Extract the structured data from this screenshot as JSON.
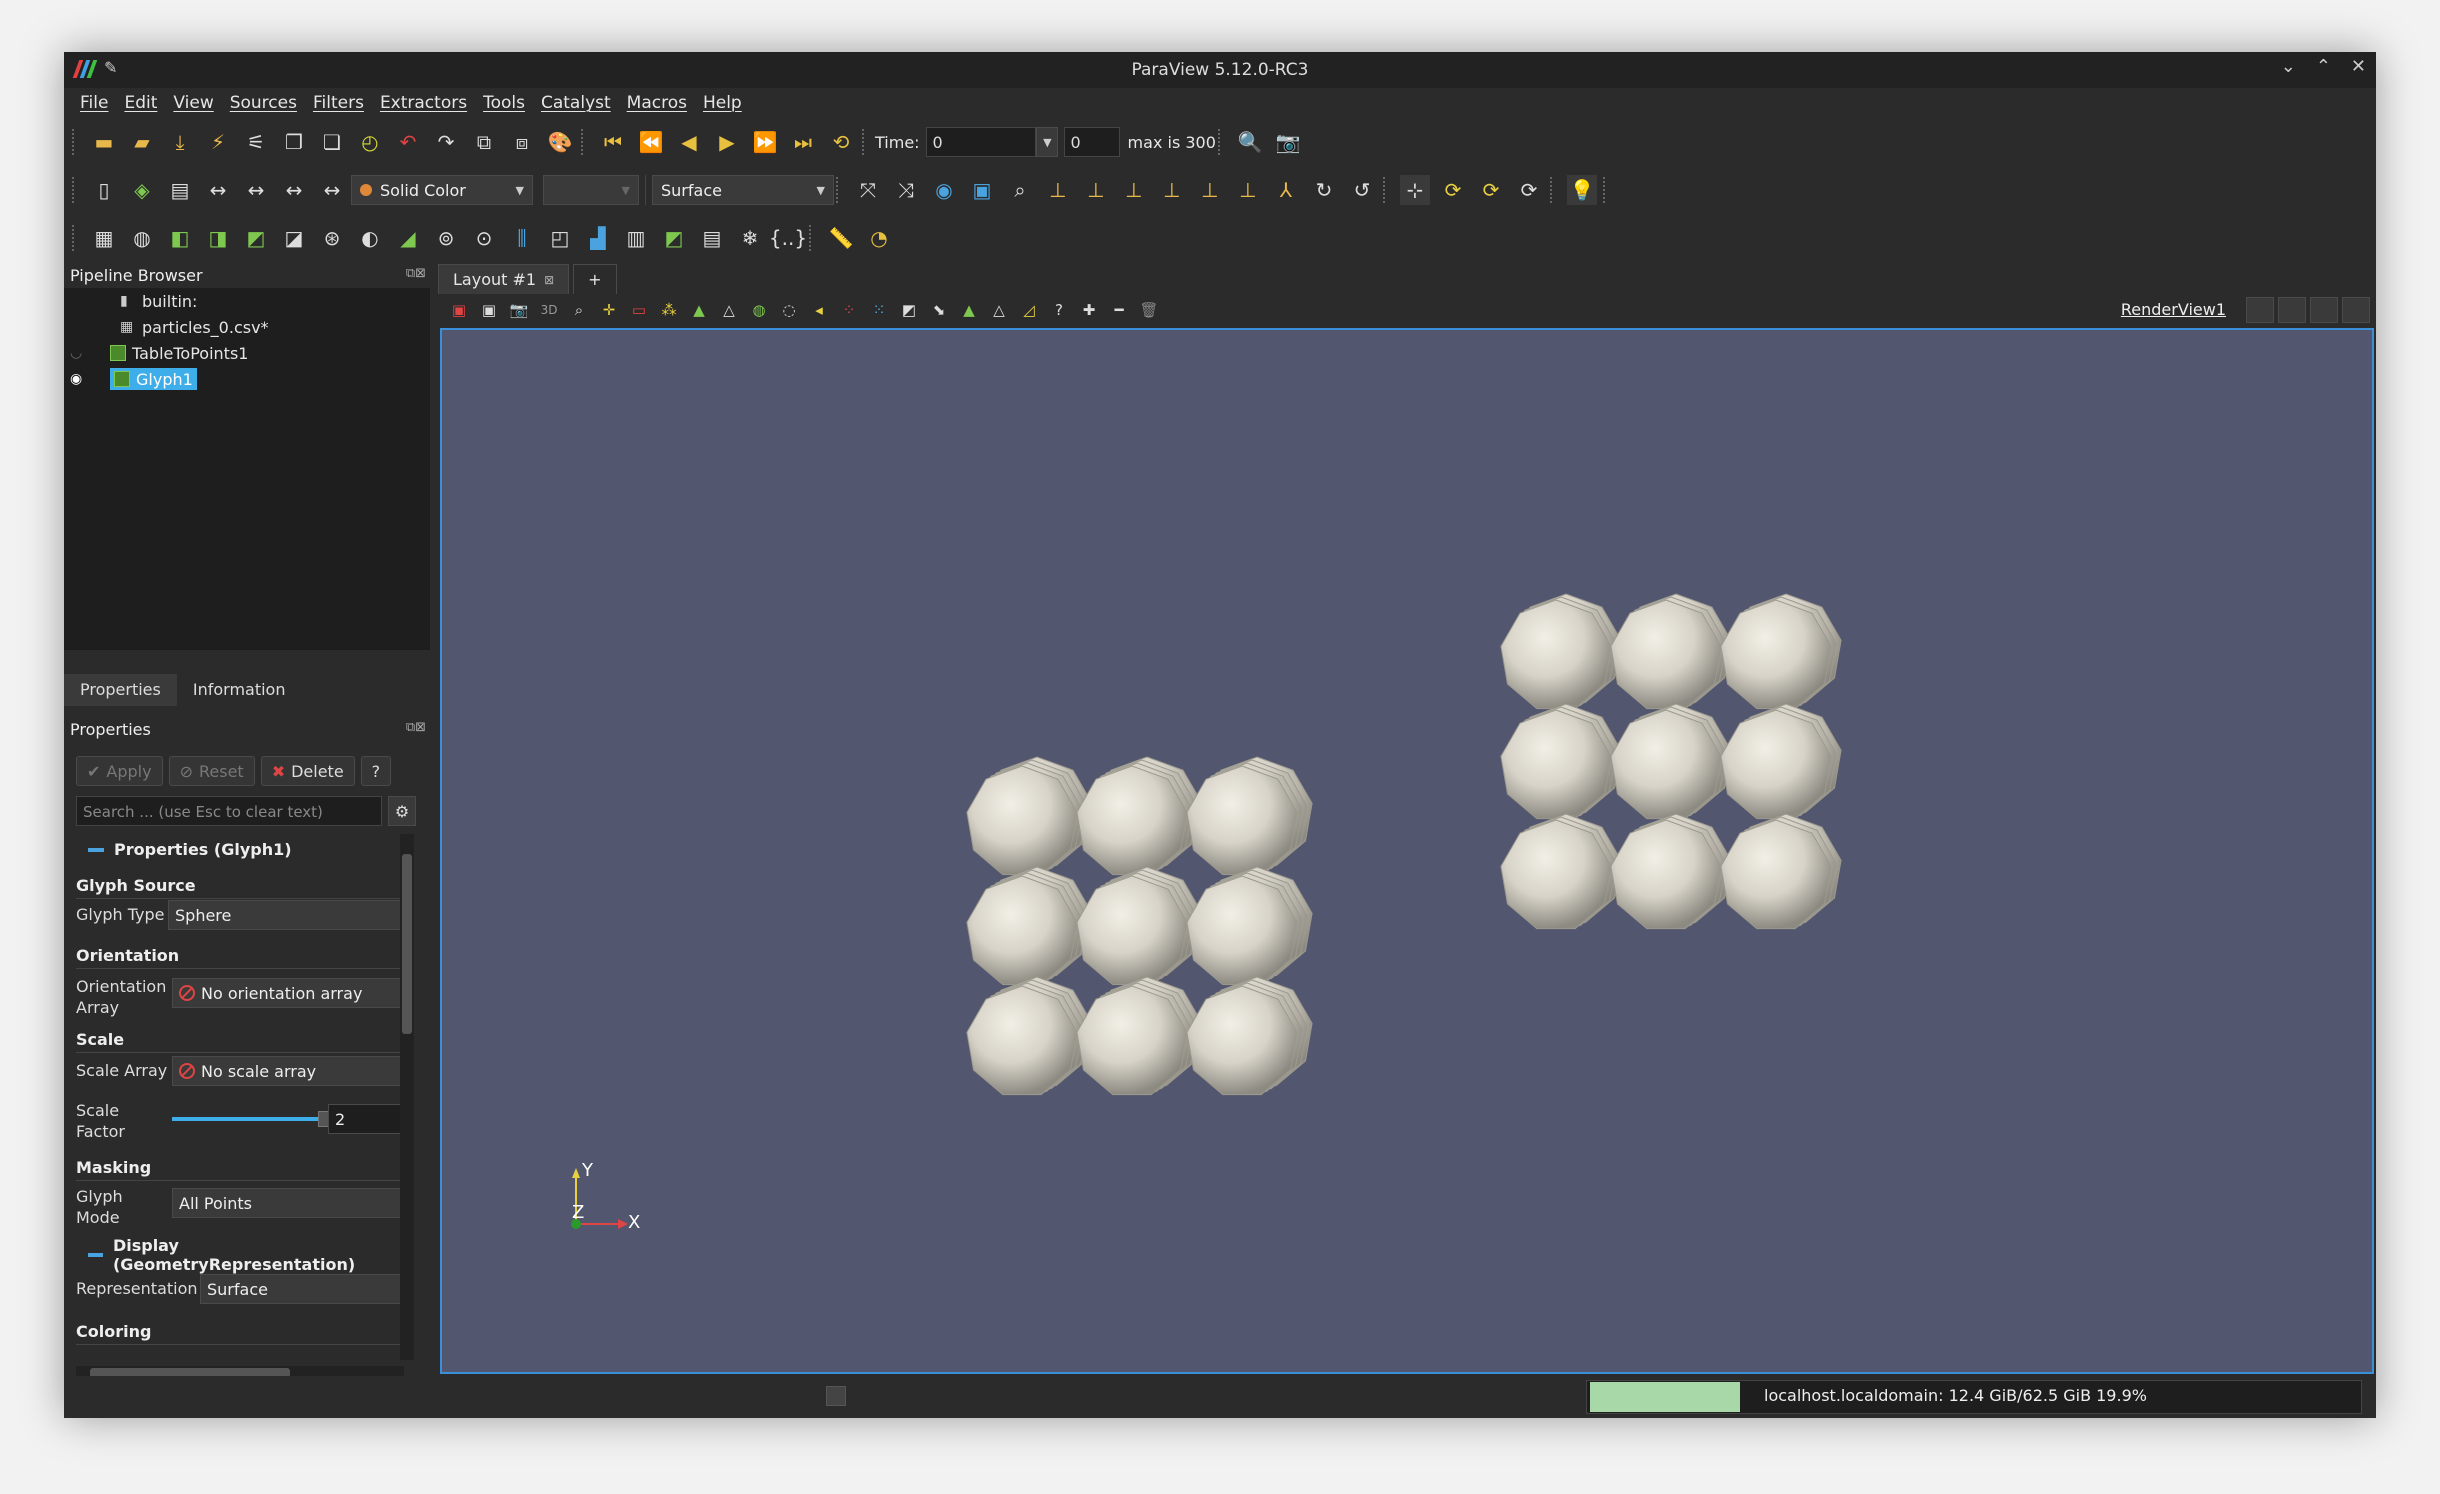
{
  "window": {
    "title": "ParaView 5.12.0-RC3"
  },
  "menu": [
    "File",
    "Edit",
    "View",
    "Sources",
    "Filters",
    "Extractors",
    "Tools",
    "Catalyst",
    "Macros",
    "Help"
  ],
  "time": {
    "label": "Time:",
    "value": "0",
    "index": "0",
    "max_label": "max is 300"
  },
  "toolbar2": {
    "color_by": "Solid Color",
    "representation": "Surface"
  },
  "pipeline": {
    "title": "Pipeline Browser",
    "items": [
      {
        "label": "builtin:"
      },
      {
        "label": "particles_0.csv*"
      },
      {
        "label": "TableToPoints1"
      },
      {
        "label": "Glyph1"
      }
    ]
  },
  "tabs": {
    "properties": "Properties",
    "information": "Information"
  },
  "properties": {
    "title": "Properties",
    "apply": "Apply",
    "reset": "Reset",
    "delete": "Delete",
    "help": "?",
    "search_placeholder": "Search ... (use Esc to clear text)",
    "group1": "Properties (Glyph1)",
    "glyph_source": "Glyph Source",
    "glyph_type_label": "Glyph Type",
    "glyph_type_value": "Sphere",
    "orientation": "Orientation",
    "orientation_array_label_1": "Orientation",
    "orientation_array_label_2": "Array",
    "orientation_array_value": "No orientation array",
    "scale": "Scale",
    "scale_array_label": "Scale Array",
    "scale_array_value": "No scale array",
    "scale_factor_label_1": "Scale",
    "scale_factor_label_2": "Factor",
    "scale_factor_value": "2",
    "masking": "Masking",
    "glyph_mode_label_1": "Glyph",
    "glyph_mode_label_2": "Mode",
    "glyph_mode_value": "All Points",
    "group2": "Display (GeometryRepresentation)",
    "representation_label": "Representation",
    "representation_value": "Surface",
    "coloring": "Coloring"
  },
  "layout": {
    "tab": "Layout #1",
    "add": "+",
    "view_name": "RenderView1"
  },
  "axes": {
    "x": "X",
    "y": "Y",
    "z": "Z"
  },
  "status": {
    "memory": "localhost.localdomain: 12.4 GiB/62.5 GiB 19.9%"
  },
  "colors": {
    "bg": "#2b2b2b",
    "render_bg": "#52566e",
    "highlight": "#3b8fd9",
    "selected": "#3daee9"
  }
}
